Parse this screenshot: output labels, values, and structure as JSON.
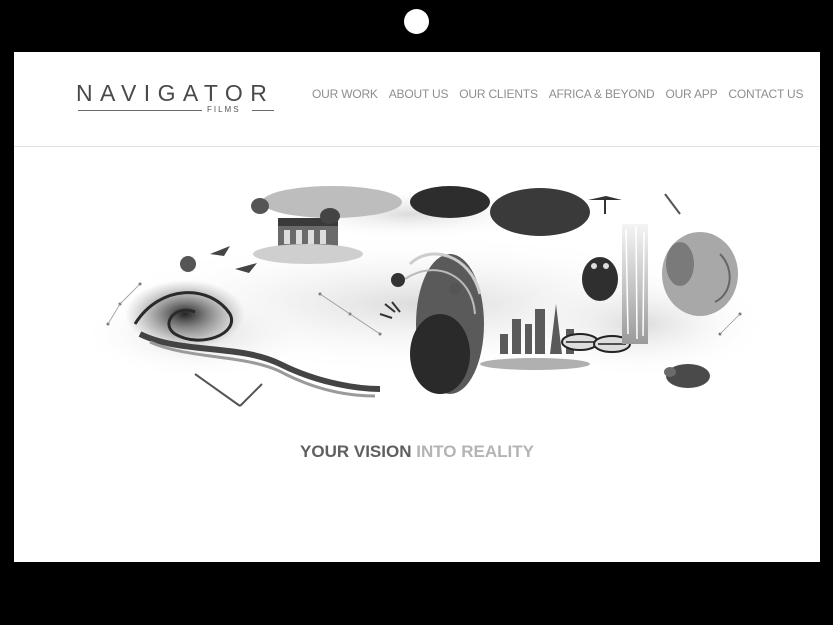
{
  "brand": {
    "name": "NAVIGATOR",
    "sub": "FILMS"
  },
  "nav": {
    "items": [
      {
        "label": "OUR WORK"
      },
      {
        "label": "ABOUT US"
      },
      {
        "label": "OUR CLIENTS"
      },
      {
        "label": "AFRICA & BEYOND"
      },
      {
        "label": "OUR APP"
      },
      {
        "label": "CONTACT US"
      }
    ]
  },
  "hero": {
    "image": "monochrome-collage-artwork"
  },
  "tagline": {
    "strong": "YOUR VISION",
    "light": "INTO REALITY"
  },
  "colors": {
    "bezel": "#000000",
    "screen": "#ffffff",
    "nav_text": "#8e8e8e",
    "tagline_dark": "#5f5f5f",
    "tagline_light": "#b4b4b4"
  }
}
